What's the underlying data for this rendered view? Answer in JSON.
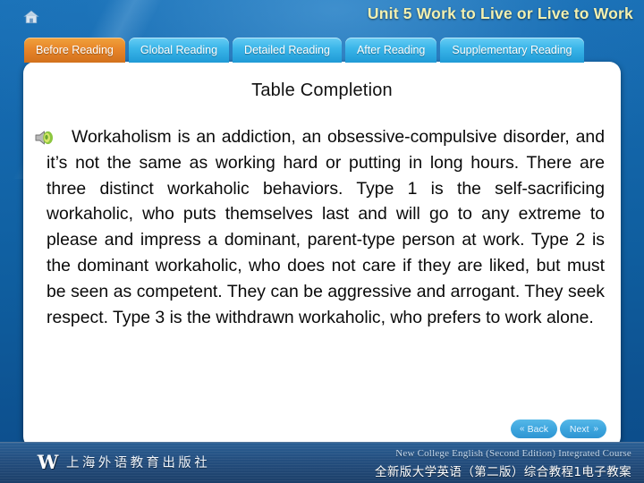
{
  "header": {
    "home_icon": "home-icon",
    "title": "Unit 5  Work to Live or Live to Work",
    "title_color": "#f2f0b0"
  },
  "tabs": [
    {
      "label": "Before Reading",
      "active": true
    },
    {
      "label": "Global Reading",
      "active": false
    },
    {
      "label": "Detailed Reading",
      "active": false
    },
    {
      "label": "After Reading",
      "active": false
    },
    {
      "label": "Supplementary Reading",
      "active": false
    }
  ],
  "panel": {
    "title": "Table Completion",
    "audio_icon": "speaker-icon",
    "paragraph": "Workaholism is an addiction, an obsessive-compulsive disorder, and it’s not the same as working hard or putting in long hours. There are three distinct workaholic behaviors. Type 1 is the self-sacrificing workaholic, who puts themselves last and will go to any extreme to please and impress a dominant, parent-type person at work. Type 2 is the dominant workaholic, who does not care if they are liked, but must be seen as competent. They can be aggressive and arrogant. They seek respect. Type 3 is the withdrawn workaholic, who prefers to work alone."
  },
  "nav": {
    "back_label": "Back",
    "back_icon": "chevron-double-left-icon",
    "back_chevron": "«",
    "next_label": "Next",
    "next_icon": "chevron-double-right-icon",
    "next_chevron": "»"
  },
  "footer": {
    "logo_mark": "W",
    "publisher_cn": "上海外语教育出版社",
    "course_en": "New College English (Second Edition) Integrated Course",
    "course_cn": "全新版大学英语（第二版）综合教程1电子教案"
  },
  "theme": {
    "accent_active_tab": "#e8862a",
    "tab_blue": "#3bb6e9",
    "background_blue": "#0f5e9f",
    "panel_bg": "#ffffff"
  }
}
